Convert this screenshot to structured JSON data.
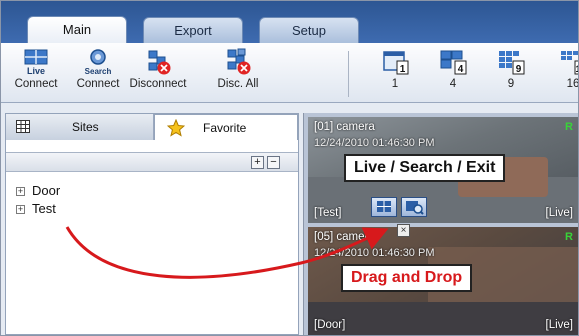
{
  "tabs": [
    {
      "label": "Main",
      "active": true
    },
    {
      "label": "Export",
      "active": false
    },
    {
      "label": "Setup",
      "active": false
    }
  ],
  "toolbar": {
    "live_connect": {
      "icon_text": "Live",
      "label": "Connect"
    },
    "search_connect": {
      "icon_text": "Search",
      "label": "Connect"
    },
    "disconnect": {
      "label": "Disconnect"
    },
    "disc_all": {
      "label": "Disc. All"
    },
    "layouts": [
      {
        "label": "1",
        "badge": "1"
      },
      {
        "label": "4",
        "badge": "4"
      },
      {
        "label": "9",
        "badge": "9"
      },
      {
        "label": "16",
        "badge": "16"
      }
    ]
  },
  "sidebar": {
    "tabs": [
      {
        "label": "Sites",
        "icon": "grid-icon"
      },
      {
        "label": "Favorite",
        "icon": "star-icon"
      }
    ],
    "controls": {
      "add": "+",
      "remove": "−"
    },
    "tree": [
      {
        "label": "Door"
      },
      {
        "label": "Test"
      }
    ]
  },
  "cameras": [
    {
      "name": "[01] camera",
      "timestamp": "12/24/2010 01:46:30 PM",
      "site": "[Test]",
      "mode": "[Live]",
      "rec": "R"
    },
    {
      "name": "[05] camera",
      "timestamp": "12/24/2010 01:46:30 PM",
      "site": "[Door]",
      "mode": "[Live]",
      "rec": "R"
    }
  ],
  "overlays": {
    "live_search_exit": "Live / Search / Exit",
    "drag_and_drop": "Drag and Drop",
    "close_glyph": "×"
  },
  "colors": {
    "tab_strip": "#2d5693",
    "annotation_arrow": "#d7191c",
    "rec_indicator": "#39d339"
  }
}
